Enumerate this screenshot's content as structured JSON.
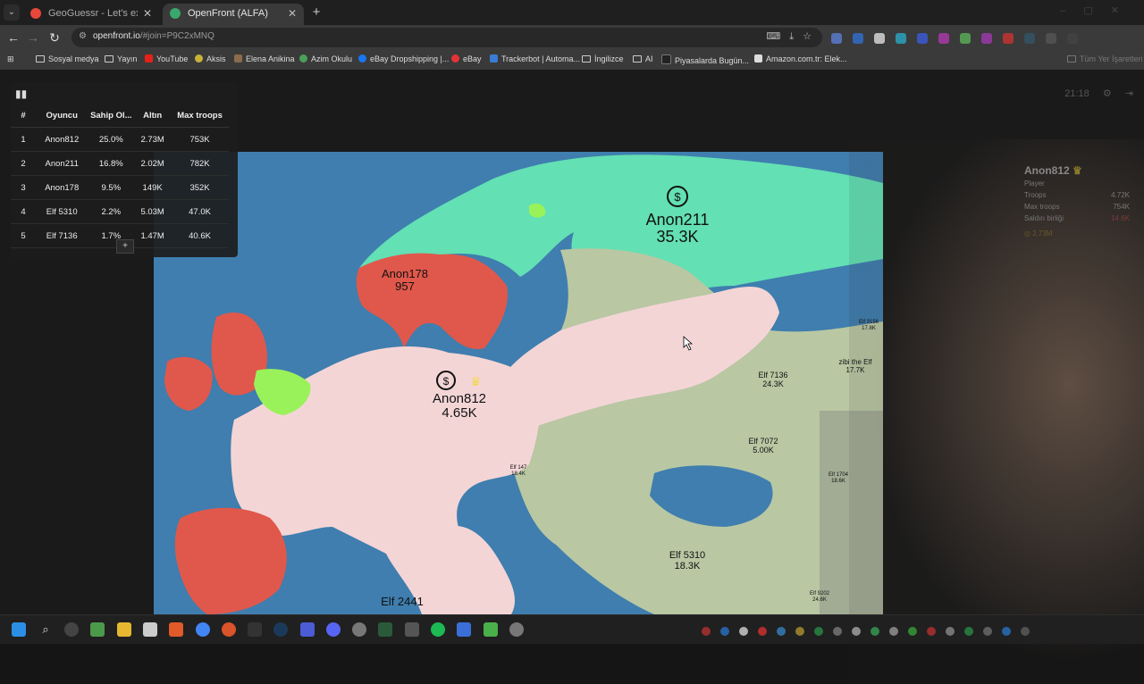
{
  "browser": {
    "tabs": [
      {
        "title": "GeoGuessr - Let's explore the w",
        "active": false,
        "favicon_color": "#e8473b"
      },
      {
        "title": "OpenFront (ALFA)",
        "active": true,
        "favicon_color": "#3aa76d"
      }
    ],
    "url": {
      "host": "openfront.io",
      "path": "/#join=P9C2xMNQ"
    },
    "bookmarks": [
      {
        "label": "Sosyal medya",
        "icon": "folder-icon"
      },
      {
        "label": "Yayın",
        "icon": "folder-icon"
      },
      {
        "label": "YouTube",
        "icon": "youtube-icon",
        "color": "#e62117"
      },
      {
        "label": "Aksis",
        "icon": "aksis-icon",
        "color": "#c9b23a"
      },
      {
        "label": "Elena Anikina",
        "icon": "profile-icon",
        "color": "#8a6c4a"
      },
      {
        "label": "Azim Okulu",
        "icon": "azim-icon",
        "color": "#4aa05a"
      },
      {
        "label": "eBay Dropshipping |...",
        "icon": "facebook-icon",
        "color": "#1877f2"
      },
      {
        "label": "eBay",
        "icon": "ebay-icon",
        "color": "#e53238"
      },
      {
        "label": "Trackerbot | Automa...",
        "icon": "trackerbot-icon",
        "color": "#3a7bd5"
      },
      {
        "label": "İngilizce",
        "icon": "folder-icon"
      },
      {
        "label": "AI",
        "icon": "folder-icon"
      },
      {
        "label": "Piyasalarda Bugün...",
        "icon": "yt-icon",
        "color": "#222"
      },
      {
        "label": "Amazon.com.tr: Elek...",
        "icon": "amazon-icon",
        "color": "#ddd"
      }
    ],
    "bookmarks_right": "Tüm Yer İşaretleri"
  },
  "leaderboard": {
    "headers": [
      "#",
      "Oyuncu",
      "Sahip Ol...",
      "Altın",
      "Max troops"
    ],
    "rows": [
      [
        "1",
        "Anon812",
        "25.0%",
        "2.73M",
        "753K"
      ],
      [
        "2",
        "Anon211",
        "16.8%",
        "2.02M",
        "782K"
      ],
      [
        "3",
        "Anon178",
        "9.5%",
        "149K",
        "352K"
      ],
      [
        "4",
        "Elf 5310",
        "2.2%",
        "5.03M",
        "47.0K"
      ],
      [
        "5",
        "Elf 7136",
        "1.7%",
        "1.47M",
        "40.6K"
      ]
    ],
    "expand_label": "+"
  },
  "hud": {
    "time": "21:18"
  },
  "player_panel": {
    "name": "Anon812",
    "type": "Player",
    "rows": [
      {
        "label": "Troops",
        "value": "4.72K"
      },
      {
        "label": "Max troops",
        "value": "754K"
      },
      {
        "label": "Saldırı birliği",
        "value": "14.6K"
      }
    ],
    "gold": "2.73M"
  },
  "map_labels": [
    {
      "name": "Anon211",
      "troops": "35.3K",
      "size": "big"
    },
    {
      "name": "Anon178",
      "troops": "957",
      "size": "medium"
    },
    {
      "name": "Anon812",
      "troops": "4.65K",
      "size": "big"
    },
    {
      "name": "Elf 7136",
      "troops": "24.3K",
      "size": "small"
    },
    {
      "name": "zibi the Elf",
      "troops": "17.7K",
      "size": "small"
    },
    {
      "name": "Elf 7072",
      "troops": "5.00K",
      "size": "small"
    },
    {
      "name": "Elf 5310",
      "troops": "18.3K",
      "size": "medium"
    },
    {
      "name": "Elf 2441",
      "troops": "",
      "size": "medium"
    },
    {
      "name": "Elf 1704",
      "troops": "18.6K",
      "size": "tiny"
    },
    {
      "name": "Elf 3156",
      "troops": "17.8K",
      "size": "tiny"
    },
    {
      "name": "Elf 147",
      "troops": "18.4K",
      "size": "tiny"
    },
    {
      "name": "Elf 9202",
      "troops": "24.6K",
      "size": "tiny"
    }
  ],
  "colors": {
    "sea": "#3f7eae",
    "anon812": "#f4d5d6",
    "anon211": "#63e0b4",
    "anon178": "#e0584b",
    "green_bot": "#9af25a",
    "elf_lands": "#b9c7a3"
  }
}
